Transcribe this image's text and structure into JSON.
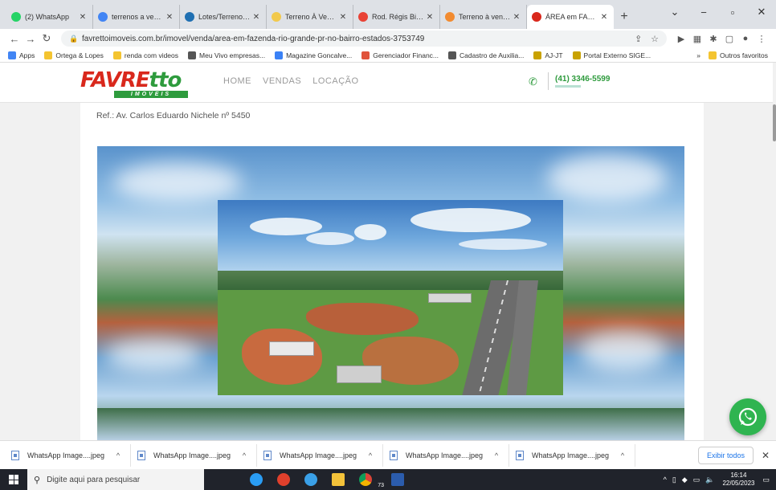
{
  "browser": {
    "tabs": [
      {
        "label": "(2) WhatsApp",
        "favicon": "whatsapp-icon",
        "color": "#25d366",
        "active": false
      },
      {
        "label": "terrenos a venda fa",
        "favicon": "google-icon",
        "color": "#4285f4",
        "active": false
      },
      {
        "label": "Lotes/Terrenos à ve",
        "favicon": "site-icon",
        "color": "#1f6fb2",
        "active": false
      },
      {
        "label": "Terreno À Venda - F",
        "favicon": "site-icon",
        "color": "#f2c94c",
        "active": false
      },
      {
        "label": "Rod. Régis Bittenco",
        "favicon": "maps-pin-icon",
        "color": "#e94235",
        "active": false
      },
      {
        "label": "Terreno à venda no",
        "favicon": "site-icon",
        "color": "#f28b30",
        "active": false
      },
      {
        "label": "ÁREA em FAZENDA",
        "favicon": "site-icon",
        "color": "#d9281c",
        "active": true
      }
    ],
    "url": "favrettoimoveis.com.br/imovel/venda/area-em-fazenda-rio-grande-pr-no-bairro-estados-3753749",
    "bookmarks": [
      {
        "label": "Apps",
        "color": "#4285f4"
      },
      {
        "label": "Ortega & Lopes",
        "color": "#f4c430"
      },
      {
        "label": "renda com videos",
        "color": "#f4c430"
      },
      {
        "label": "Meu Vivo empresas...",
        "color": "#555555"
      },
      {
        "label": "Magazine Goncalve...",
        "color": "#3b82f6"
      },
      {
        "label": "Gerenciador Financ...",
        "color": "#e0533b"
      },
      {
        "label": "Cadastro de Auxilia...",
        "color": "#555555"
      },
      {
        "label": "AJ-JT",
        "color": "#c9a200"
      },
      {
        "label": "Portal Externo SIGE...",
        "color": "#c9a200"
      }
    ],
    "bookmarks_more": "»",
    "other_bookmarks": "Outros favoritos"
  },
  "site": {
    "logo_main_1": "FAVRE",
    "logo_main_2": "tto",
    "logo_sub": "IMOVEIS",
    "nav": [
      "HOME",
      "VENDAS",
      "LOCAÇÃO"
    ],
    "phone": "(41) 3346-5599"
  },
  "listing": {
    "ref": "Ref.: Av. Carlos Eduardo Nichele nº 5450"
  },
  "downloads": {
    "items": [
      "WhatsApp Image....jpeg",
      "WhatsApp Image....jpeg",
      "WhatsApp Image....jpeg",
      "WhatsApp Image....jpeg",
      "WhatsApp Image....jpeg"
    ],
    "show_all": "Exibir todos"
  },
  "taskbar": {
    "search_placeholder": "Digite aqui para pesquisar",
    "badge_count": "73",
    "time": "16:14",
    "date": "22/05/2023"
  },
  "colors": {
    "brand_red": "#d9281c",
    "brand_green": "#2e9b3d",
    "whatsapp_green": "#2fb450"
  }
}
